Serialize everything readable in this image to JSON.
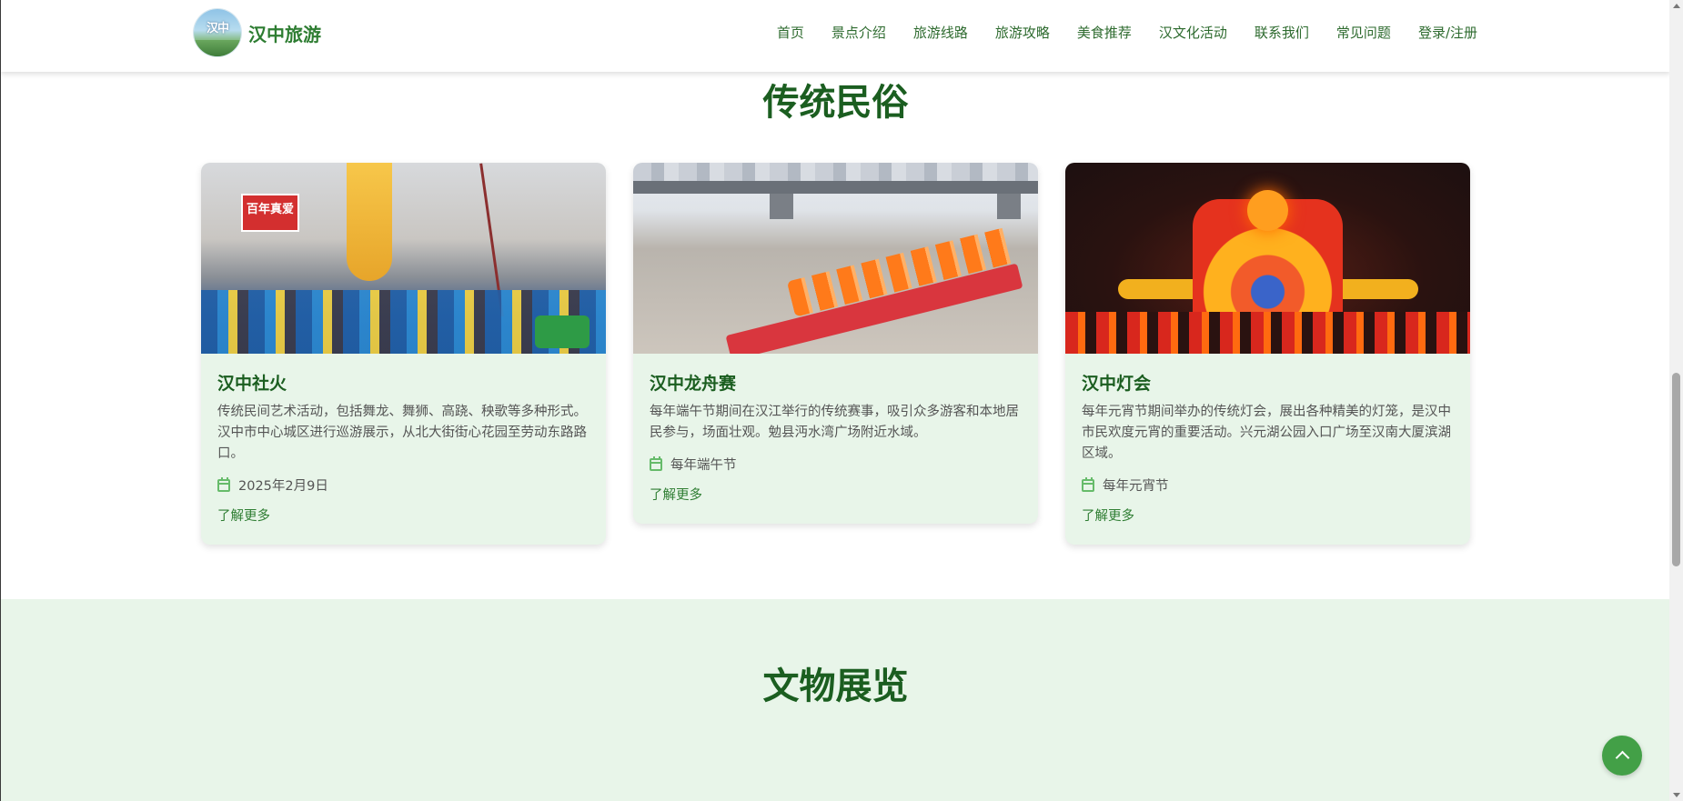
{
  "header": {
    "logo_glyph": "汉中",
    "site_name": "汉中旅游",
    "nav": [
      "首页",
      "景点介绍",
      "旅游线路",
      "旅游攻略",
      "美食推荐",
      "汉文化活动",
      "联系我们",
      "常见问题",
      "登录/注册"
    ]
  },
  "sections": {
    "folk_title": "传统民俗",
    "relics_title": "文物展览"
  },
  "cards": [
    {
      "image_sign": "百年真爱",
      "title": "汉中社火",
      "desc": "传统民间艺术活动，包括舞龙、舞狮、高跷、秧歌等多种形式。汉中市中心城区进行巡游展示，从北大街街心花园至劳动东路路口。",
      "date": "2025年2月9日",
      "more": "了解更多"
    },
    {
      "title": "汉中龙舟赛",
      "desc": "每年端午节期间在汉江举行的传统赛事，吸引众多游客和本地居民参与，场面壮观。勉县沔水湾广场附近水域。",
      "date": "每年端午节",
      "more": "了解更多"
    },
    {
      "title": "汉中灯会",
      "desc": "每年元宵节期间举办的传统灯会，展出各种精美的灯笼，是汉中市民欢度元宵的重要活动。兴元湖公园入口广场至汉南大厦滨湖区域。",
      "date": "每年元宵节",
      "more": "了解更多"
    }
  ],
  "colors": {
    "accent": "#2e7d32",
    "title": "#1b5e20",
    "card_bg": "#e8f5e9",
    "to_top": "#43a047"
  },
  "icons": {
    "date": "calendar-icon",
    "back_to_top": "chevron-up-icon"
  }
}
